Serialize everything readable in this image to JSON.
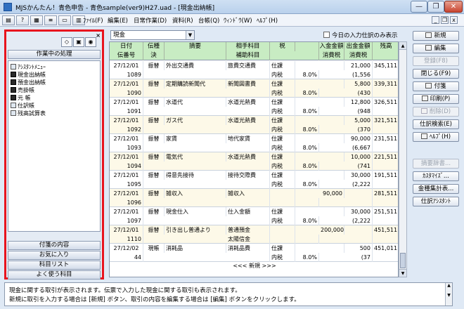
{
  "window": {
    "title": "MJSかんたん！青色申告 - 青色sample(ver9)H27.uad - [現金出納帳]",
    "min_glyph": "—",
    "max_glyph": "❐",
    "close_glyph": "✕"
  },
  "menu": {
    "items": [
      "ﾌｧｲﾙ(F)",
      "編集(E)",
      "日常作業(D)",
      "資料(R)",
      "台帳(Q)",
      "ｳｨﾝﾄﾞｳ(W)",
      "ﾍﾙﾌﾟ(H)"
    ],
    "mdi_min": "_",
    "mdi_restore": "❐",
    "mdi_close": "x"
  },
  "left_panel": {
    "close_glyph": "×",
    "header": "作業中の処理",
    "tree": [
      "ｱｼｽﾀﾝﾄﾒﾆｭｰ",
      "現金出納帳",
      "預金出納帳",
      "売掛帳",
      "元 帳",
      "仕訳帳",
      "残高試算表"
    ],
    "bottom_buttons": [
      "付箋の内容",
      "お気に入り",
      "科目リスト",
      "よく使う科目"
    ]
  },
  "toolbar": {
    "account": "現金",
    "today_only_label": "今日の入力仕訳のみ表示"
  },
  "grid": {
    "header_top": [
      "日付",
      "伝種",
      "摘要",
      "相手科目",
      "税",
      "入金金額",
      "出金金額",
      "残高"
    ],
    "header_bottom": [
      "伝番号",
      "決",
      "",
      "補助科目",
      "",
      "消費税",
      "消費税",
      ""
    ],
    "rows": [
      {
        "date": "27/12/01",
        "slip_type": "振替",
        "desc": "外出交通費",
        "account": "旅費交通費",
        "tax": "仕課",
        "tax_rate": "8.0%",
        "deposit": "",
        "withdrawal": "21,000",
        "withdrawal_tax": "(1,556",
        "balance": "345,111",
        "slip_no": "1089",
        "sub_account": "",
        "tax_code": "内税"
      },
      {
        "date": "27/12/01",
        "slip_type": "振替",
        "desc": "定期購読新聞代",
        "account": "新聞図書費",
        "tax": "仕課",
        "tax_rate": "8.0%",
        "deposit": "",
        "withdrawal": "5,800",
        "withdrawal_tax": "(430",
        "balance": "339,311",
        "slip_no": "1090",
        "sub_account": "",
        "tax_code": "内税"
      },
      {
        "date": "27/12/01",
        "slip_type": "振替",
        "desc": "水道代",
        "account": "水道光熱費",
        "tax": "仕課",
        "tax_rate": "8.0%",
        "deposit": "",
        "withdrawal": "12,800",
        "withdrawal_tax": "(948",
        "balance": "326,511",
        "slip_no": "1091",
        "sub_account": "",
        "tax_code": "内税"
      },
      {
        "date": "27/12/01",
        "slip_type": "振替",
        "desc": "ガス代",
        "account": "水道光熱費",
        "tax": "仕課",
        "tax_rate": "8.0%",
        "deposit": "",
        "withdrawal": "5,000",
        "withdrawal_tax": "(370",
        "balance": "321,511",
        "slip_no": "1092",
        "sub_account": "",
        "tax_code": "内税"
      },
      {
        "date": "27/12/01",
        "slip_type": "振替",
        "desc": "家賃",
        "account": "地代家賃",
        "tax": "仕課",
        "tax_rate": "8.0%",
        "deposit": "",
        "withdrawal": "90,000",
        "withdrawal_tax": "(6,667",
        "balance": "231,511",
        "slip_no": "1093",
        "sub_account": "",
        "tax_code": "内税"
      },
      {
        "date": "27/12/01",
        "slip_type": "振替",
        "desc": "電気代",
        "account": "水道光熱費",
        "tax": "仕課",
        "tax_rate": "8.0%",
        "deposit": "",
        "withdrawal": "10,000",
        "withdrawal_tax": "(741",
        "balance": "221,511",
        "slip_no": "1094",
        "sub_account": "",
        "tax_code": "内税"
      },
      {
        "date": "27/12/01",
        "slip_type": "振替",
        "desc": "得意先接待",
        "account": "接待交際費",
        "tax": "仕課",
        "tax_rate": "8.0%",
        "deposit": "",
        "withdrawal": "30,000",
        "withdrawal_tax": "(2,222",
        "balance": "191,511",
        "slip_no": "1095",
        "sub_account": "",
        "tax_code": "内税"
      },
      {
        "date": "27/12/01",
        "slip_type": "振替",
        "desc": "雑収入",
        "account": "雑収入",
        "tax": "",
        "tax_rate": "",
        "deposit": "90,000",
        "withdrawal": "",
        "withdrawal_tax": "",
        "balance": "281,511",
        "slip_no": "1096",
        "sub_account": "",
        "tax_code": ""
      },
      {
        "date": "27/12/01",
        "slip_type": "振替",
        "desc": "現金仕入",
        "account": "仕入金額",
        "tax": "仕課",
        "tax_rate": "8.0%",
        "deposit": "",
        "withdrawal": "30,000",
        "withdrawal_tax": "(2,222",
        "balance": "251,511",
        "slip_no": "1097",
        "sub_account": "",
        "tax_code": "内税"
      },
      {
        "date": "27/12/01",
        "slip_type": "振替",
        "desc": "引き出し普通より",
        "account": "普通預金",
        "tax": "",
        "tax_rate": "",
        "deposit": "200,000",
        "withdrawal": "",
        "withdrawal_tax": "",
        "balance": "451,511",
        "slip_no": "1110",
        "sub_account": "太陽信金",
        "tax_code": ""
      },
      {
        "date": "27/12/02",
        "slip_type": "現帳",
        "desc": "消耗品",
        "account": "消耗品費",
        "tax": "仕課",
        "tax_rate": "8.0%",
        "deposit": "",
        "withdrawal": "500",
        "withdrawal_tax": "(37",
        "balance": "451,011",
        "slip_no": "44",
        "sub_account": "",
        "tax_code": "内税"
      }
    ],
    "new_row_label": "<<< 新規 >>>"
  },
  "right_buttons": [
    {
      "label": "新規",
      "enabled": true
    },
    {
      "label": "編集",
      "enabled": true
    },
    {
      "label": "登録(F8)",
      "enabled": false
    },
    {
      "label": "閉じる(F9)",
      "enabled": true
    },
    {
      "label": "付箋",
      "enabled": true
    },
    {
      "label": "印刷(P)",
      "enabled": true
    },
    {
      "label": "削除(D)",
      "enabled": false
    },
    {
      "label": "仕訳検索(E)",
      "enabled": true
    },
    {
      "label": "ﾍﾙﾌﾟ(H)",
      "enabled": true
    },
    {
      "label": "摘要辞書...",
      "enabled": false
    },
    {
      "label": "ｶｽﾀﾏｲｽﾞ...",
      "enabled": true
    },
    {
      "label": "金種集計表...",
      "enabled": true
    },
    {
      "label": "仕訳ｱｼｽﾀﾝﾄ",
      "enabled": true
    }
  ],
  "status": {
    "line1": "現金に関する取引が表示されます。伝票で入力した現金に関する取引も表示されます。",
    "line2": "新規に取引を入力する場合は [新規] ボタン、取引の内容を編集する場合は [編集] ボタンをクリックします。"
  }
}
